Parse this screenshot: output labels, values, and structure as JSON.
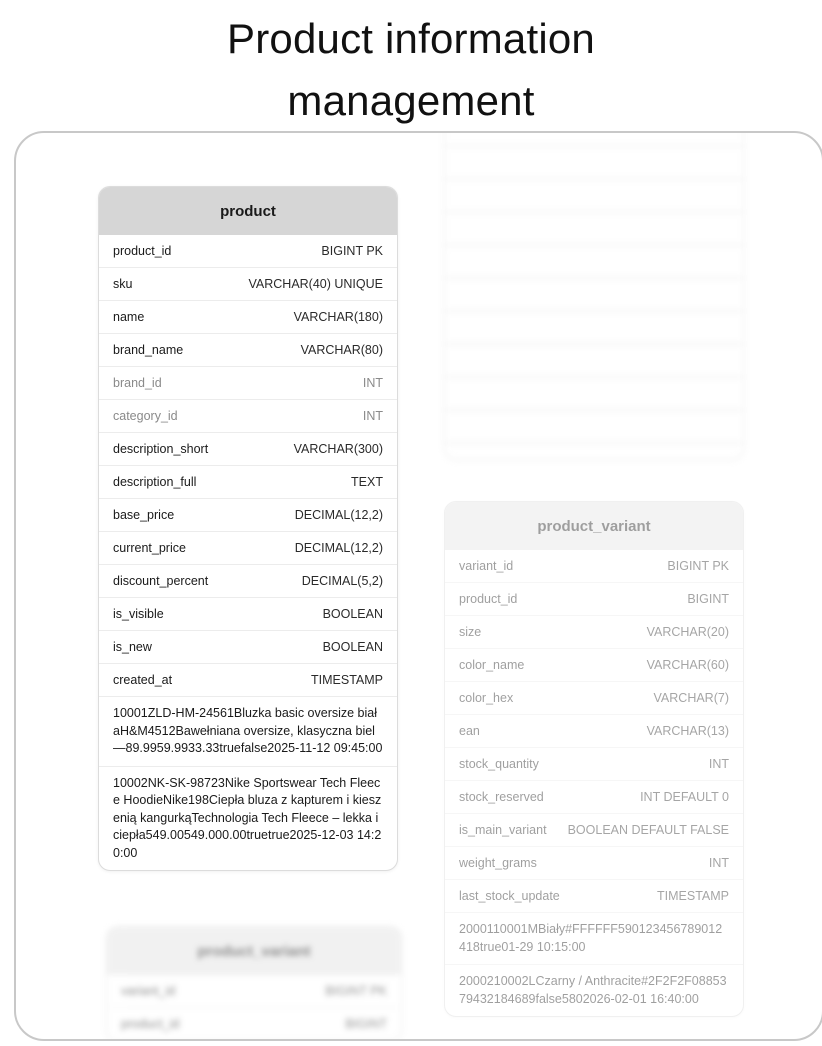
{
  "page": {
    "title_line1": "Product information",
    "title_line2": "management"
  },
  "product_table": {
    "name": "product",
    "columns": [
      {
        "name": "product_id",
        "type": "BIGINT PK",
        "muted": false
      },
      {
        "name": "sku",
        "type": "VARCHAR(40) UNIQUE",
        "muted": false
      },
      {
        "name": "name",
        "type": "VARCHAR(180)",
        "muted": false
      },
      {
        "name": "brand_name",
        "type": "VARCHAR(80)",
        "muted": false
      },
      {
        "name": "brand_id",
        "type": "INT",
        "muted": true
      },
      {
        "name": "category_id",
        "type": "INT",
        "muted": true
      },
      {
        "name": "description_short",
        "type": "VARCHAR(300)",
        "muted": false
      },
      {
        "name": "description_full",
        "type": "TEXT",
        "muted": false
      },
      {
        "name": "base_price",
        "type": "DECIMAL(12,2)",
        "muted": false
      },
      {
        "name": "current_price",
        "type": "DECIMAL(12,2)",
        "muted": false
      },
      {
        "name": "discount_percent",
        "type": "DECIMAL(5,2)",
        "muted": false
      },
      {
        "name": "is_visible",
        "type": "BOOLEAN",
        "muted": false
      },
      {
        "name": "is_new",
        "type": "BOOLEAN",
        "muted": false
      },
      {
        "name": "created_at",
        "type": "TIMESTAMP",
        "muted": false
      }
    ],
    "samples": [
      "10001ZLD-HM-24561Bluzka basic oversize białaH&M4512Bawełniana oversize, klasyczna biel—89.9959.9933.33truefalse2025-11-12 09:45:00",
      "10002NK-SK-98723Nike Sportswear Tech Fleece HoodieNike198Ciepła bluza z kapturem i kieszenią kangurkąTechnologia Tech Fleece – lekka i ciepła549.00549.000.00truetrue2025-12-03 14:20:00"
    ]
  },
  "variant_table": {
    "name": "product_variant",
    "columns": [
      {
        "name": "variant_id",
        "type": "BIGINT PK"
      },
      {
        "name": "product_id",
        "type": "BIGINT"
      },
      {
        "name": "size",
        "type": "VARCHAR(20)"
      },
      {
        "name": "color_name",
        "type": "VARCHAR(60)"
      },
      {
        "name": "color_hex",
        "type": "VARCHAR(7)"
      },
      {
        "name": "ean",
        "type": "VARCHAR(13)"
      },
      {
        "name": "stock_quantity",
        "type": "INT"
      },
      {
        "name": "stock_reserved",
        "type": "INT DEFAULT 0"
      },
      {
        "name": "is_main_variant",
        "type": "BOOLEAN DEFAULT FALSE"
      },
      {
        "name": "weight_grams",
        "type": "INT"
      },
      {
        "name": "last_stock_update",
        "type": "TIMESTAMP"
      }
    ],
    "samples": [
      "2000110001MBiały#FFFFFF590123456789012418true01-29 10:15:00",
      "2000210002LCzarny / Anthracite#2F2F2F0885379432184689false5802026-02-01 16:40:00"
    ]
  },
  "variant_table_bottom": {
    "name": "product_variant",
    "columns": [
      {
        "name": "variant_id",
        "type": "BIGINT PK"
      },
      {
        "name": "product_id",
        "type": "BIGINT"
      }
    ]
  }
}
